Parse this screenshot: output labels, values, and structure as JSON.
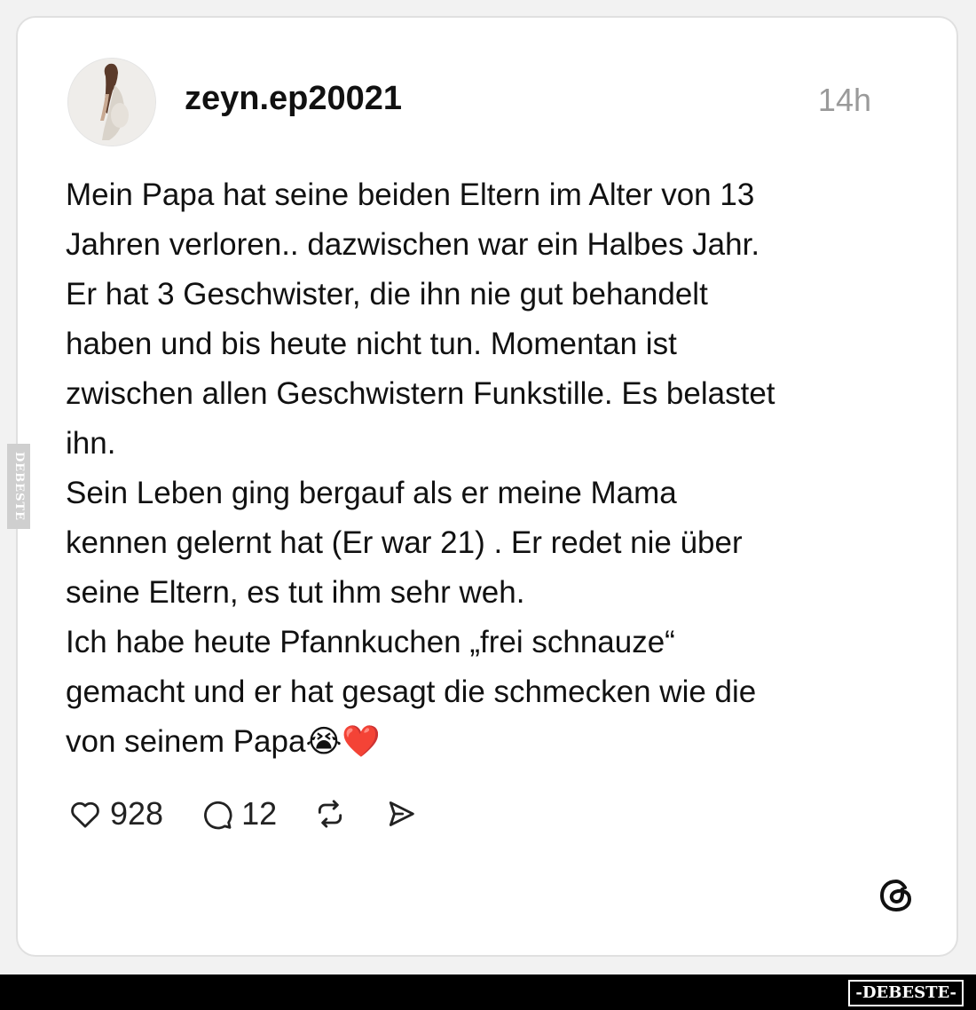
{
  "post": {
    "username": "zeyn.ep20021",
    "timestamp": "14h",
    "text_lines": [
      "Mein Papa hat seine beiden Eltern im Alter von 13",
      "Jahren verloren.. dazwischen war ein Halbes Jahr.",
      "Er hat 3 Geschwister, die ihn nie gut behandelt",
      "haben und bis heute nicht tun. Momentan ist",
      "zwischen allen Geschwistern Funkstille. Es belastet",
      "ihn.",
      "Sein Leben ging bergauf als er meine Mama",
      "kennen gelernt hat (Er war 21) . Er redet nie über",
      "seine Eltern, es tut ihm sehr weh.",
      "Ich habe heute Pfannkuchen „frei schnauze“",
      "gemacht und er hat gesagt die schmecken wie die",
      "von seinem Papa😭❤️"
    ]
  },
  "actions": {
    "likes": "928",
    "comments": "12",
    "like_icon": "heart-icon",
    "comment_icon": "comment-bubble-icon",
    "repost_icon": "repost-icon",
    "share_icon": "send-icon"
  },
  "branding": {
    "threads_logo": "threads-logo-icon",
    "side_watermark": "DEBESTE",
    "footer_watermark": "-DEBESTE-"
  }
}
